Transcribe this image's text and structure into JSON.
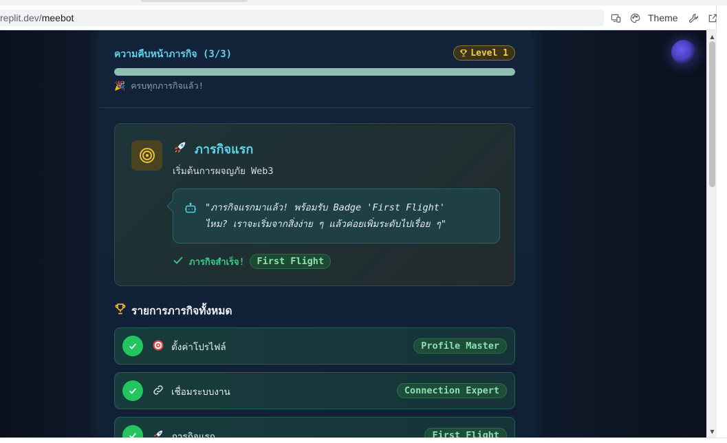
{
  "browser": {
    "url_host": "replit.dev/",
    "url_path": "meebot",
    "theme_label": "Theme"
  },
  "progress": {
    "title": "ความคืบหน้าภารกิจ (3/3)",
    "level": "Level 1",
    "fraction": 1.0,
    "note": "ครบทุกภารกิจแล้ว!"
  },
  "current_mission": {
    "title": "ภารกิจแรก",
    "subtitle": "เริ่มต้นการผจญภัย Web3",
    "quote_line1": "\"ภารกิจแรกมาแล้ว! พร้อมรับ Badge 'First Flight'",
    "quote_line2": "ไหม? เราจะเริ่มจากสิ่งง่าย ๆ แล้วค่อยเพิ่มระดับไปเรื่อย ๆ\"",
    "done_text": "ภารกิจสำเร็จ!",
    "badge": "First Flight"
  },
  "mission_list": {
    "title": "รายการภารกิจทั้งหมด",
    "items": [
      {
        "label": "ตั้งค่าโปรไฟล์",
        "badge": "Profile Master",
        "icon": "target-icon"
      },
      {
        "label": "เชื่อมระบบงาน",
        "badge": "Connection Expert",
        "icon": "link-icon"
      },
      {
        "label": "ภารกิจแรก",
        "badge": "First Flight",
        "icon": "rocket-icon"
      }
    ]
  },
  "colors": {
    "accent_cyan": "#5fd3e8",
    "success_green": "#22c55e",
    "level_gold": "#f2cf4a"
  }
}
